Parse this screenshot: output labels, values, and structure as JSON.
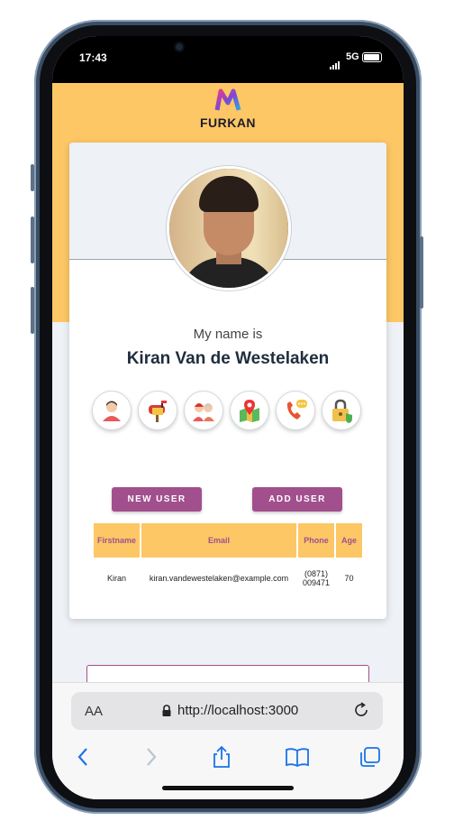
{
  "status_bar": {
    "time": "17:43",
    "network": "5G"
  },
  "app": {
    "logo_text": "FURKAN"
  },
  "profile": {
    "intro": "My name is",
    "full_name": "Kiran Van de Westelaken"
  },
  "icon_row": [
    {
      "icon": "user-icon"
    },
    {
      "icon": "mailbox-icon"
    },
    {
      "icon": "couple-icon"
    },
    {
      "icon": "map-pin-icon"
    },
    {
      "icon": "phone-chat-icon"
    },
    {
      "icon": "lock-icon"
    }
  ],
  "actions": {
    "new_user": "NEW USER",
    "add_user": "ADD USER"
  },
  "table": {
    "headers": {
      "firstname": "Firstname",
      "email": "Email",
      "phone": "Phone",
      "age": "Age"
    },
    "rows": [
      {
        "firstname": "Kiran",
        "email": "kiran.vandewestelaken@example.com",
        "phone_line1": "(0871)",
        "phone_line2": "009471",
        "age": "70"
      }
    ]
  },
  "browser": {
    "aa_label": "AA",
    "url": "http://localhost:3000"
  },
  "colors": {
    "accent_yellow": "#fdc765",
    "accent_purple": "#a24f8d"
  }
}
